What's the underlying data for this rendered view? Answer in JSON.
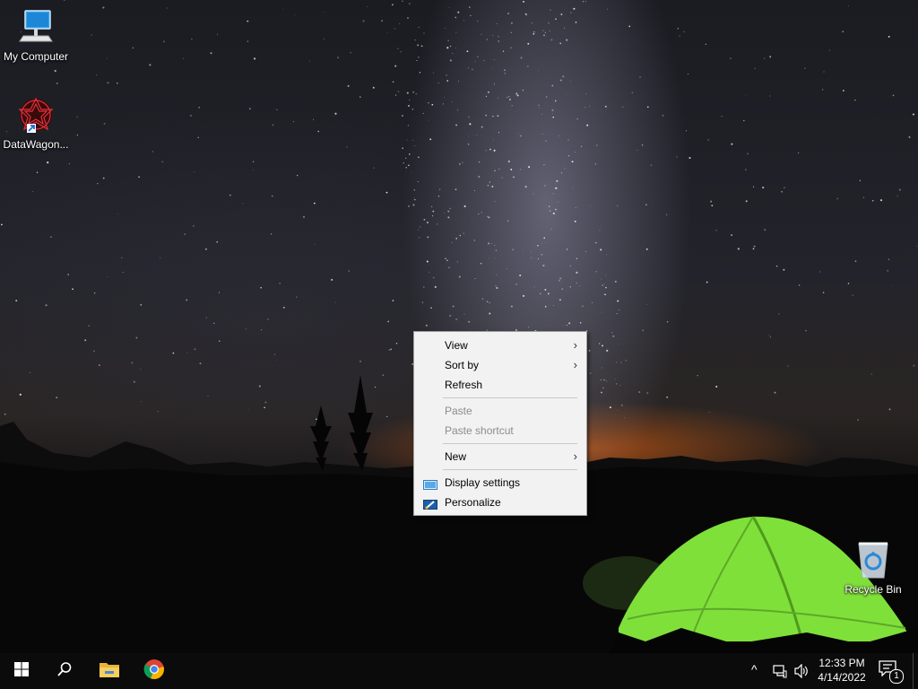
{
  "desktop": {
    "icons": [
      {
        "label": "My Computer",
        "icon": "monitor-icon"
      },
      {
        "label": "DataWagon...",
        "icon": "datawagon-shortcut-icon"
      },
      {
        "label": "Recycle Bin",
        "icon": "recycle-bin-icon"
      }
    ]
  },
  "context_menu": {
    "items": [
      {
        "label": "View",
        "submenu": true,
        "enabled": true
      },
      {
        "label": "Sort by",
        "submenu": true,
        "enabled": true
      },
      {
        "label": "Refresh",
        "submenu": false,
        "enabled": true
      },
      {
        "label": "Paste",
        "submenu": false,
        "enabled": false
      },
      {
        "label": "Paste shortcut",
        "submenu": false,
        "enabled": false
      },
      {
        "label": "New",
        "submenu": true,
        "enabled": true
      },
      {
        "label": "Display settings",
        "submenu": false,
        "enabled": true,
        "icon": "display-settings-icon"
      },
      {
        "label": "Personalize",
        "submenu": false,
        "enabled": true,
        "icon": "personalize-icon"
      }
    ],
    "submenu_arrow": "›"
  },
  "taskbar": {
    "buttons": [
      "start-icon",
      "search-icon",
      "file-explorer-icon",
      "chrome-icon"
    ],
    "tray": {
      "chevron": "^",
      "network_icon": "network-icon",
      "volume_icon": "volume-icon"
    },
    "clock": {
      "time": "12:33 PM",
      "date": "4/14/2022"
    },
    "notifications": {
      "count": "1"
    }
  },
  "colors": {
    "menu_bg": "#f2f2f2",
    "taskbar_bg": "#0b0b0c",
    "tent_green": "#7fe03a"
  }
}
